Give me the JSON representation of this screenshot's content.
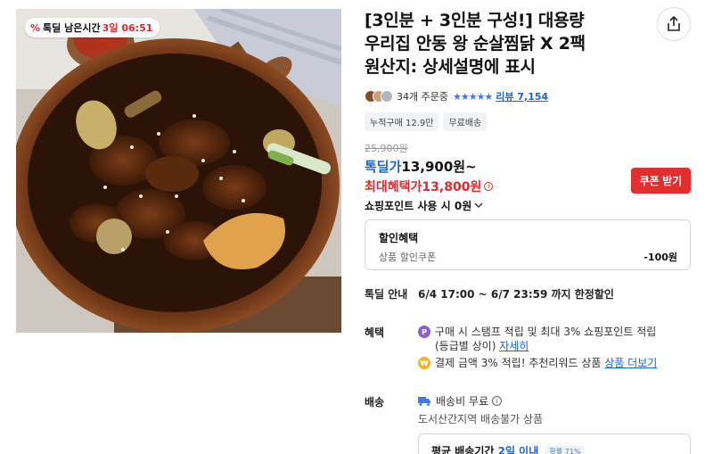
{
  "timer": {
    "label": "톡딜 남은시간",
    "days": "3일",
    "time": "06:51"
  },
  "product": {
    "title_line1": "[3인분 + 3인분 구성!] 대용량",
    "title_line2": "우리집 안동 왕 순살찜닭 X 2팩",
    "title_line3": "원산지: 상세설명에 표시"
  },
  "rating": {
    "orders": "34개 주문중",
    "stars": "★★★★★",
    "reviews": "리뷰 7,154"
  },
  "chips": [
    "누적구매 12.9만",
    "무료배송"
  ],
  "price": {
    "original": "25,900원",
    "deal_label": "톡딜가",
    "deal_value": "13,900원~",
    "max_label": "최대혜택가",
    "max_value": "13,800원",
    "info_glyph": "i"
  },
  "coupon_button": "쿠폰 받기",
  "shopping_point": "쇼핑포인트 사용 시 0원",
  "discount": {
    "heading": "할인혜택",
    "label": "상품 할인쿠폰",
    "amount": "-100원"
  },
  "deal_info": {
    "title": "톡딜 안내",
    "period": "6/4 17:00 ~ 6/7 23:59 까지 한정할인"
  },
  "benefits": {
    "title": "혜택",
    "item1_text": "구매 시 스탬프 적립 및 최대 3% 쇼핑포인트 적립",
    "item1_text2": "(등급별 상이)",
    "item1_link": "자세히",
    "item2_text": "결제 금액 3% 적립! 추천리워드 상품",
    "item2_link": "상품 더보기",
    "icon1_glyph": "P",
    "icon2_glyph": "₩"
  },
  "shipping": {
    "title": "배송",
    "fee": "배송비 무료",
    "note": "도서산간지역 배송불가 상품",
    "arrival_label": "평균 배송기간",
    "arrival_value": "2일 이내",
    "arrival_badge": "확률 71%"
  },
  "colors": {
    "accent_blue": "#1e64d8",
    "accent_red": "#e0282e",
    "star_blue": "#3b7bf6"
  }
}
